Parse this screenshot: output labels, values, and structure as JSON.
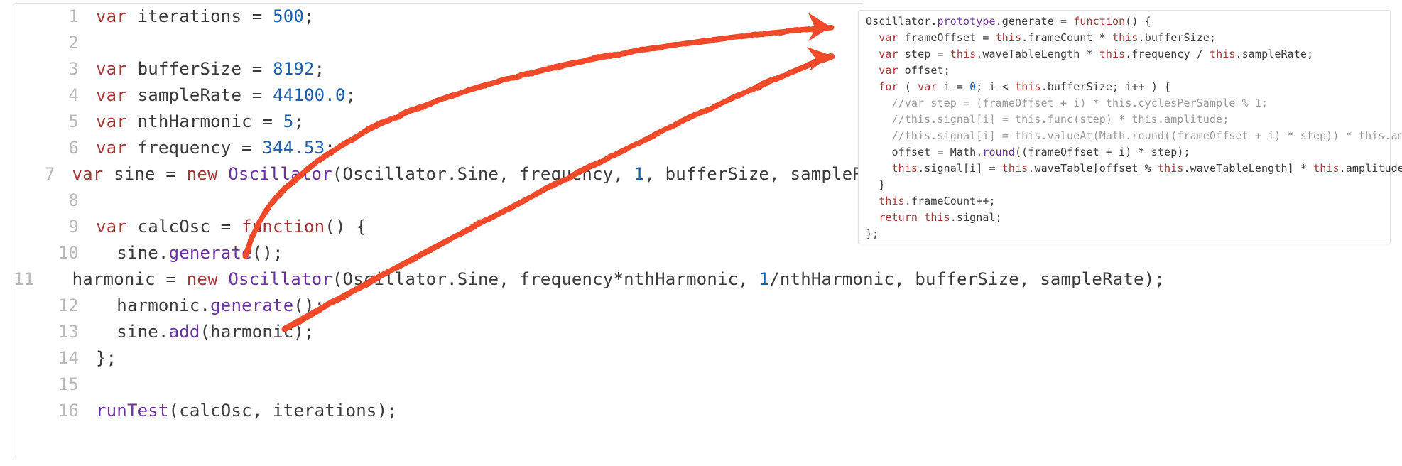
{
  "editor": {
    "lines": [
      {
        "n": "1",
        "tokens": [
          [
            "kw",
            "var"
          ],
          [
            "id",
            " iterations "
          ],
          [
            "op",
            "= "
          ],
          [
            "num",
            "500"
          ],
          [
            "op",
            ";"
          ]
        ]
      },
      {
        "n": "2",
        "tokens": []
      },
      {
        "n": "3",
        "tokens": [
          [
            "kw",
            "var"
          ],
          [
            "id",
            " bufferSize "
          ],
          [
            "op",
            "= "
          ],
          [
            "num",
            "8192"
          ],
          [
            "op",
            ";"
          ]
        ]
      },
      {
        "n": "4",
        "tokens": [
          [
            "kw",
            "var"
          ],
          [
            "id",
            " sampleRate "
          ],
          [
            "op",
            "= "
          ],
          [
            "num",
            "44100.0"
          ],
          [
            "op",
            ";"
          ]
        ]
      },
      {
        "n": "5",
        "tokens": [
          [
            "kw",
            "var"
          ],
          [
            "id",
            " nthHarmonic "
          ],
          [
            "op",
            "= "
          ],
          [
            "num",
            "5"
          ],
          [
            "op",
            ";"
          ]
        ]
      },
      {
        "n": "6",
        "tokens": [
          [
            "kw",
            "var"
          ],
          [
            "id",
            " frequency "
          ],
          [
            "op",
            "= "
          ],
          [
            "num",
            "344.53"
          ],
          [
            "op",
            ";"
          ]
        ]
      },
      {
        "n": "7",
        "tokens": [
          [
            "kw",
            "var"
          ],
          [
            "id",
            " sine "
          ],
          [
            "op",
            "= "
          ],
          [
            "kw",
            "new"
          ],
          [
            "id",
            " "
          ],
          [
            "fn",
            "Oscillator"
          ],
          [
            "op",
            "("
          ],
          [
            "id",
            "Oscillator"
          ],
          [
            "op",
            "."
          ],
          [
            "id",
            "Sine"
          ],
          [
            "op",
            ", "
          ],
          [
            "id",
            "frequency"
          ],
          [
            "op",
            ", "
          ],
          [
            "num",
            "1"
          ],
          [
            "op",
            ", "
          ],
          [
            "id",
            "bufferSize"
          ],
          [
            "op",
            ", "
          ],
          [
            "id",
            "sampleR"
          ]
        ]
      },
      {
        "n": "8",
        "tokens": []
      },
      {
        "n": "9",
        "tokens": [
          [
            "kw",
            "var"
          ],
          [
            "id",
            " calcOsc "
          ],
          [
            "op",
            "= "
          ],
          [
            "kw",
            "function"
          ],
          [
            "op",
            "() {"
          ]
        ]
      },
      {
        "n": "10",
        "tokens": [
          [
            "id",
            "  sine"
          ],
          [
            "op",
            "."
          ],
          [
            "fn",
            "generate"
          ],
          [
            "op",
            "();"
          ]
        ]
      },
      {
        "n": "11",
        "tokens": [
          [
            "id",
            "  harmonic "
          ],
          [
            "op",
            "= "
          ],
          [
            "kw",
            "new"
          ],
          [
            "id",
            " "
          ],
          [
            "fn",
            "Oscillator"
          ],
          [
            "op",
            "("
          ],
          [
            "id",
            "Oscillator"
          ],
          [
            "op",
            "."
          ],
          [
            "id",
            "Sine"
          ],
          [
            "op",
            ", "
          ],
          [
            "id",
            "frequency"
          ],
          [
            "op",
            "*"
          ],
          [
            "id",
            "nthHarmonic"
          ],
          [
            "op",
            ", "
          ],
          [
            "num",
            "1"
          ],
          [
            "op",
            "/"
          ],
          [
            "id",
            "nthHarmonic"
          ],
          [
            "op",
            ", "
          ],
          [
            "id",
            "bufferSize"
          ],
          [
            "op",
            ", "
          ],
          [
            "id",
            "sampleRate"
          ],
          [
            "op",
            ");"
          ]
        ]
      },
      {
        "n": "12",
        "tokens": [
          [
            "id",
            "  harmonic"
          ],
          [
            "op",
            "."
          ],
          [
            "fn",
            "generate"
          ],
          [
            "op",
            "();"
          ]
        ]
      },
      {
        "n": "13",
        "tokens": [
          [
            "id",
            "  sine"
          ],
          [
            "op",
            "."
          ],
          [
            "fn",
            "add"
          ],
          [
            "op",
            "("
          ],
          [
            "id",
            "harmonic"
          ],
          [
            "op",
            ");"
          ]
        ]
      },
      {
        "n": "14",
        "tokens": [
          [
            "op",
            "};"
          ]
        ]
      },
      {
        "n": "15",
        "tokens": []
      },
      {
        "n": "16",
        "tokens": [
          [
            "fn",
            "runTest"
          ],
          [
            "op",
            "("
          ],
          [
            "id",
            "calcOsc"
          ],
          [
            "op",
            ", "
          ],
          [
            "id",
            "iterations"
          ],
          [
            "op",
            ");"
          ]
        ]
      }
    ]
  },
  "snippet": {
    "lines": [
      [
        [
          "id",
          "Oscillator"
        ],
        [
          "op",
          "."
        ],
        [
          "fn",
          "prototype"
        ],
        [
          "op",
          "."
        ],
        [
          "id",
          "generate"
        ],
        [
          "op",
          " = "
        ],
        [
          "kw",
          "function"
        ],
        [
          "op",
          "() {"
        ]
      ],
      [
        [
          "id",
          "  "
        ],
        [
          "kw",
          "var"
        ],
        [
          "id",
          " frameOffset = "
        ],
        [
          "th",
          "this"
        ],
        [
          "op",
          "."
        ],
        [
          "id",
          "frameCount * "
        ],
        [
          "th",
          "this"
        ],
        [
          "op",
          "."
        ],
        [
          "id",
          "bufferSize;"
        ]
      ],
      [
        [
          "id",
          "  "
        ],
        [
          "kw",
          "var"
        ],
        [
          "id",
          " step = "
        ],
        [
          "th",
          "this"
        ],
        [
          "op",
          "."
        ],
        [
          "id",
          "waveTableLength * "
        ],
        [
          "th",
          "this"
        ],
        [
          "op",
          "."
        ],
        [
          "id",
          "frequency / "
        ],
        [
          "th",
          "this"
        ],
        [
          "op",
          "."
        ],
        [
          "id",
          "sampleRate;"
        ]
      ],
      [
        [
          "id",
          "  "
        ],
        [
          "kw",
          "var"
        ],
        [
          "id",
          " offset;"
        ]
      ],
      [
        [
          "id",
          ""
        ]
      ],
      [
        [
          "id",
          "  "
        ],
        [
          "kw",
          "for"
        ],
        [
          "op",
          " ( "
        ],
        [
          "kw",
          "var"
        ],
        [
          "id",
          " i = "
        ],
        [
          "num",
          "0"
        ],
        [
          "op",
          "; "
        ],
        [
          "id",
          "i < "
        ],
        [
          "th",
          "this"
        ],
        [
          "op",
          "."
        ],
        [
          "id",
          "bufferSize; i"
        ],
        [
          "op",
          "++"
        ],
        [
          "op",
          " ) {"
        ]
      ],
      [
        [
          "cm",
          "    //var step = (frameOffset + i) * this.cyclesPerSample % 1;"
        ]
      ],
      [
        [
          "cm",
          "    //this.signal[i] = this.func(step) * this.amplitude;"
        ]
      ],
      [
        [
          "cm",
          "    //this.signal[i] = this.valueAt(Math.round((frameOffset + i) * step)) * this.amplitude;"
        ]
      ],
      [
        [
          "id",
          "    offset = "
        ],
        [
          "id",
          "Math"
        ],
        [
          "op",
          "."
        ],
        [
          "fn",
          "round"
        ],
        [
          "op",
          "(("
        ],
        [
          "id",
          "frameOffset + i"
        ],
        [
          "op",
          ") * "
        ],
        [
          "id",
          "step"
        ],
        [
          "op",
          ");"
        ]
      ],
      [
        [
          "id",
          "    "
        ],
        [
          "th",
          "this"
        ],
        [
          "op",
          "."
        ],
        [
          "id",
          "signal[i] = "
        ],
        [
          "th",
          "this"
        ],
        [
          "op",
          "."
        ],
        [
          "id",
          "waveTable[offset % "
        ],
        [
          "th",
          "this"
        ],
        [
          "op",
          "."
        ],
        [
          "id",
          "waveTableLength] * "
        ],
        [
          "th",
          "this"
        ],
        [
          "op",
          "."
        ],
        [
          "id",
          "amplitude;"
        ]
      ],
      [
        [
          "op",
          "  }"
        ]
      ],
      [
        [
          "id",
          ""
        ]
      ],
      [
        [
          "id",
          "  "
        ],
        [
          "th",
          "this"
        ],
        [
          "op",
          "."
        ],
        [
          "id",
          "frameCount"
        ],
        [
          "op",
          "++;"
        ]
      ],
      [
        [
          "id",
          ""
        ]
      ],
      [
        [
          "id",
          "  "
        ],
        [
          "kw",
          "return"
        ],
        [
          "id",
          " "
        ],
        [
          "th",
          "this"
        ],
        [
          "op",
          "."
        ],
        [
          "id",
          "signal;"
        ]
      ],
      [
        [
          "op",
          "};"
        ]
      ]
    ]
  },
  "annotations": {
    "arrow1": {
      "from": "line-10-generate",
      "to": "snippet-top"
    },
    "arrow2": {
      "from": "line-12-generate",
      "to": "snippet-top"
    },
    "color": "#f04a2a"
  }
}
